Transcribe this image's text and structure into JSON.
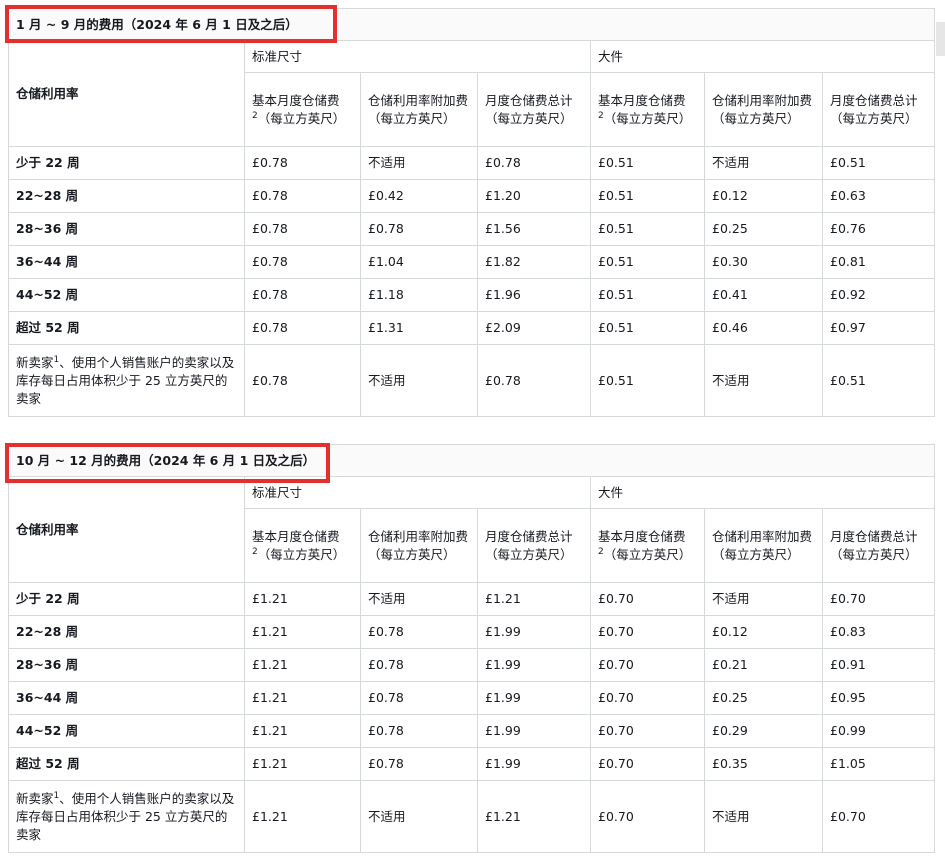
{
  "sections": [
    {
      "title": "1 月 ~ 9 月的费用（2024 年 6 月 1 日及之后）",
      "row_header": "仓储利用率",
      "groups": [
        "标准尺寸",
        "大件"
      ],
      "col_headers": [
        [
          "基本月度仓储费",
          "2",
          "（每立方英尺）"
        ],
        [
          "仓储利用率附加费（每立方英尺）"
        ],
        [
          "月度仓储费总计（每立方英尺）"
        ],
        [
          "基本月度仓储费",
          "2",
          "（每立方英尺）"
        ],
        [
          "仓储利用率附加费（每立方英尺）"
        ],
        [
          "月度仓储费总计（每立方英尺）"
        ]
      ],
      "rows": [
        {
          "label": "少于 22 周",
          "cells": [
            "£0.78",
            "不适用",
            "£0.78",
            "£0.51",
            "不适用",
            "£0.51"
          ]
        },
        {
          "label": "22~28 周",
          "cells": [
            "£0.78",
            "£0.42",
            "£1.20",
            "£0.51",
            "£0.12",
            "£0.63"
          ]
        },
        {
          "label": "28~36 周",
          "cells": [
            "£0.78",
            "£0.78",
            "£1.56",
            "£0.51",
            "£0.25",
            "£0.76"
          ]
        },
        {
          "label": "36~44 周",
          "cells": [
            "£0.78",
            "£1.04",
            "£1.82",
            "£0.51",
            "£0.30",
            "£0.81"
          ]
        },
        {
          "label": "44~52 周",
          "cells": [
            "£0.78",
            "£1.18",
            "£1.96",
            "£0.51",
            "£0.41",
            "£0.92"
          ]
        },
        {
          "label": "超过 52 周",
          "cells": [
            "£0.78",
            "£1.31",
            "£2.09",
            "£0.51",
            "£0.46",
            "£0.97"
          ]
        }
      ],
      "last_row": {
        "label_a": "新卖家",
        "sup": "1",
        "label_b": "、使用个人销售账户的卖家以及库存每日占用体积少于 25 立方英尺的卖家",
        "cells": [
          "£0.78",
          "不适用",
          "£0.78",
          "£0.51",
          "不适用",
          "£0.51"
        ]
      }
    },
    {
      "title": "10 月 ~ 12 月的费用（2024 年 6 月 1 日及之后）",
      "row_header": "仓储利用率",
      "groups": [
        "标准尺寸",
        "大件"
      ],
      "col_headers": [
        [
          "基本月度仓储费",
          "2",
          "（每立方英尺）"
        ],
        [
          "仓储利用率附加费（每立方英尺）"
        ],
        [
          "月度仓储费总计（每立方英尺）"
        ],
        [
          "基本月度仓储费",
          "2",
          "（每立方英尺）"
        ],
        [
          "仓储利用率附加费（每立方英尺）"
        ],
        [
          "月度仓储费总计（每立方英尺）"
        ]
      ],
      "rows": [
        {
          "label": "少于 22 周",
          "cells": [
            "£1.21",
            "不适用",
            "£1.21",
            "£0.70",
            "不适用",
            "£0.70"
          ]
        },
        {
          "label": "22~28 周",
          "cells": [
            "£1.21",
            "£0.78",
            "£1.99",
            "£0.70",
            "£0.12",
            "£0.83"
          ]
        },
        {
          "label": "28~36 周",
          "cells": [
            "£1.21",
            "£0.78",
            "£1.99",
            "£0.70",
            "£0.21",
            "£0.91"
          ]
        },
        {
          "label": "36~44 周",
          "cells": [
            "£1.21",
            "£0.78",
            "£1.99",
            "£0.70",
            "£0.25",
            "£0.95"
          ]
        },
        {
          "label": "44~52 周",
          "cells": [
            "£1.21",
            "£0.78",
            "£1.99",
            "£0.70",
            "£0.29",
            "£0.99"
          ]
        },
        {
          "label": "超过 52 周",
          "cells": [
            "£1.21",
            "£0.78",
            "£1.99",
            "£0.70",
            "£0.35",
            "£1.05"
          ]
        }
      ],
      "last_row": {
        "label_a": "新卖家",
        "sup": "1",
        "label_b": "、使用个人销售账户的卖家以及库存每日占用体积少于 25 立方英尺的卖家",
        "cells": [
          "£1.21",
          "不适用",
          "£1.21",
          "£0.70",
          "不适用",
          "£0.70"
        ]
      }
    }
  ],
  "colors": {
    "highlight_border": "#e3302f",
    "grid": "#d5d9d9",
    "title_bg": "#fafafa"
  }
}
